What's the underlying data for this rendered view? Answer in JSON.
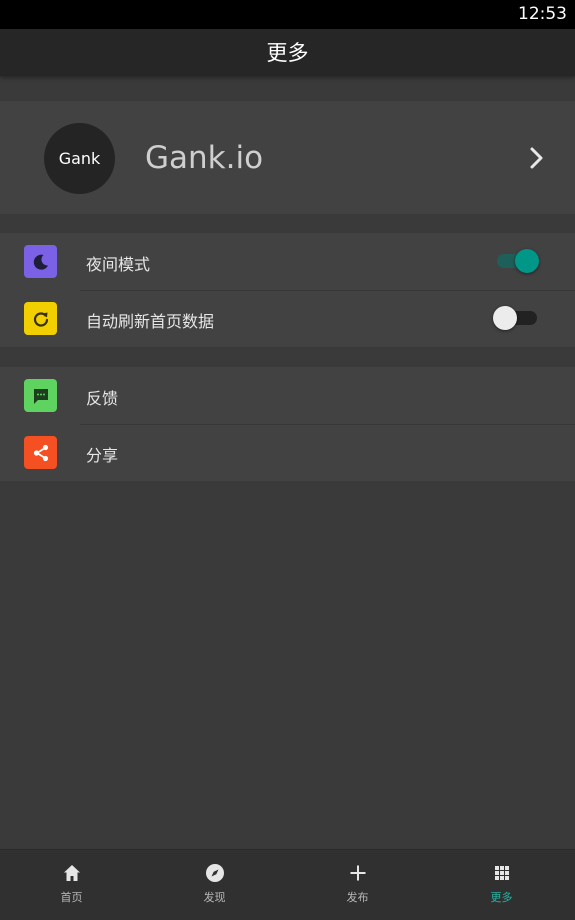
{
  "status_bar": {
    "time": "12:53"
  },
  "app_bar": {
    "title": "更多"
  },
  "profile": {
    "avatar_text": "Gank",
    "name": "Gank.io",
    "chevron_icon": "chevron-right-icon"
  },
  "settings": [
    {
      "label": "夜间模式",
      "icon": "moon-icon",
      "icon_color": "#7b61e6",
      "toggle": true
    },
    {
      "label": "自动刷新首页数据",
      "icon": "refresh-icon",
      "icon_color": "#f2d000",
      "toggle": false
    }
  ],
  "actions": [
    {
      "label": "反馈",
      "icon": "feedback-icon",
      "icon_color": "#5ed35f"
    },
    {
      "label": "分享",
      "icon": "share-icon",
      "icon_color": "#f55022"
    }
  ],
  "bottom_nav": [
    {
      "label": "首页",
      "icon": "home-icon",
      "active": false
    },
    {
      "label": "发现",
      "icon": "compass-icon",
      "active": false
    },
    {
      "label": "发布",
      "icon": "plus-icon",
      "active": false
    },
    {
      "label": "更多",
      "icon": "grid-icon",
      "active": true
    }
  ],
  "colors": {
    "accent": "#009688",
    "active_nav": "#26b3a3",
    "background": "#3a3a3a",
    "card": "#424242"
  }
}
